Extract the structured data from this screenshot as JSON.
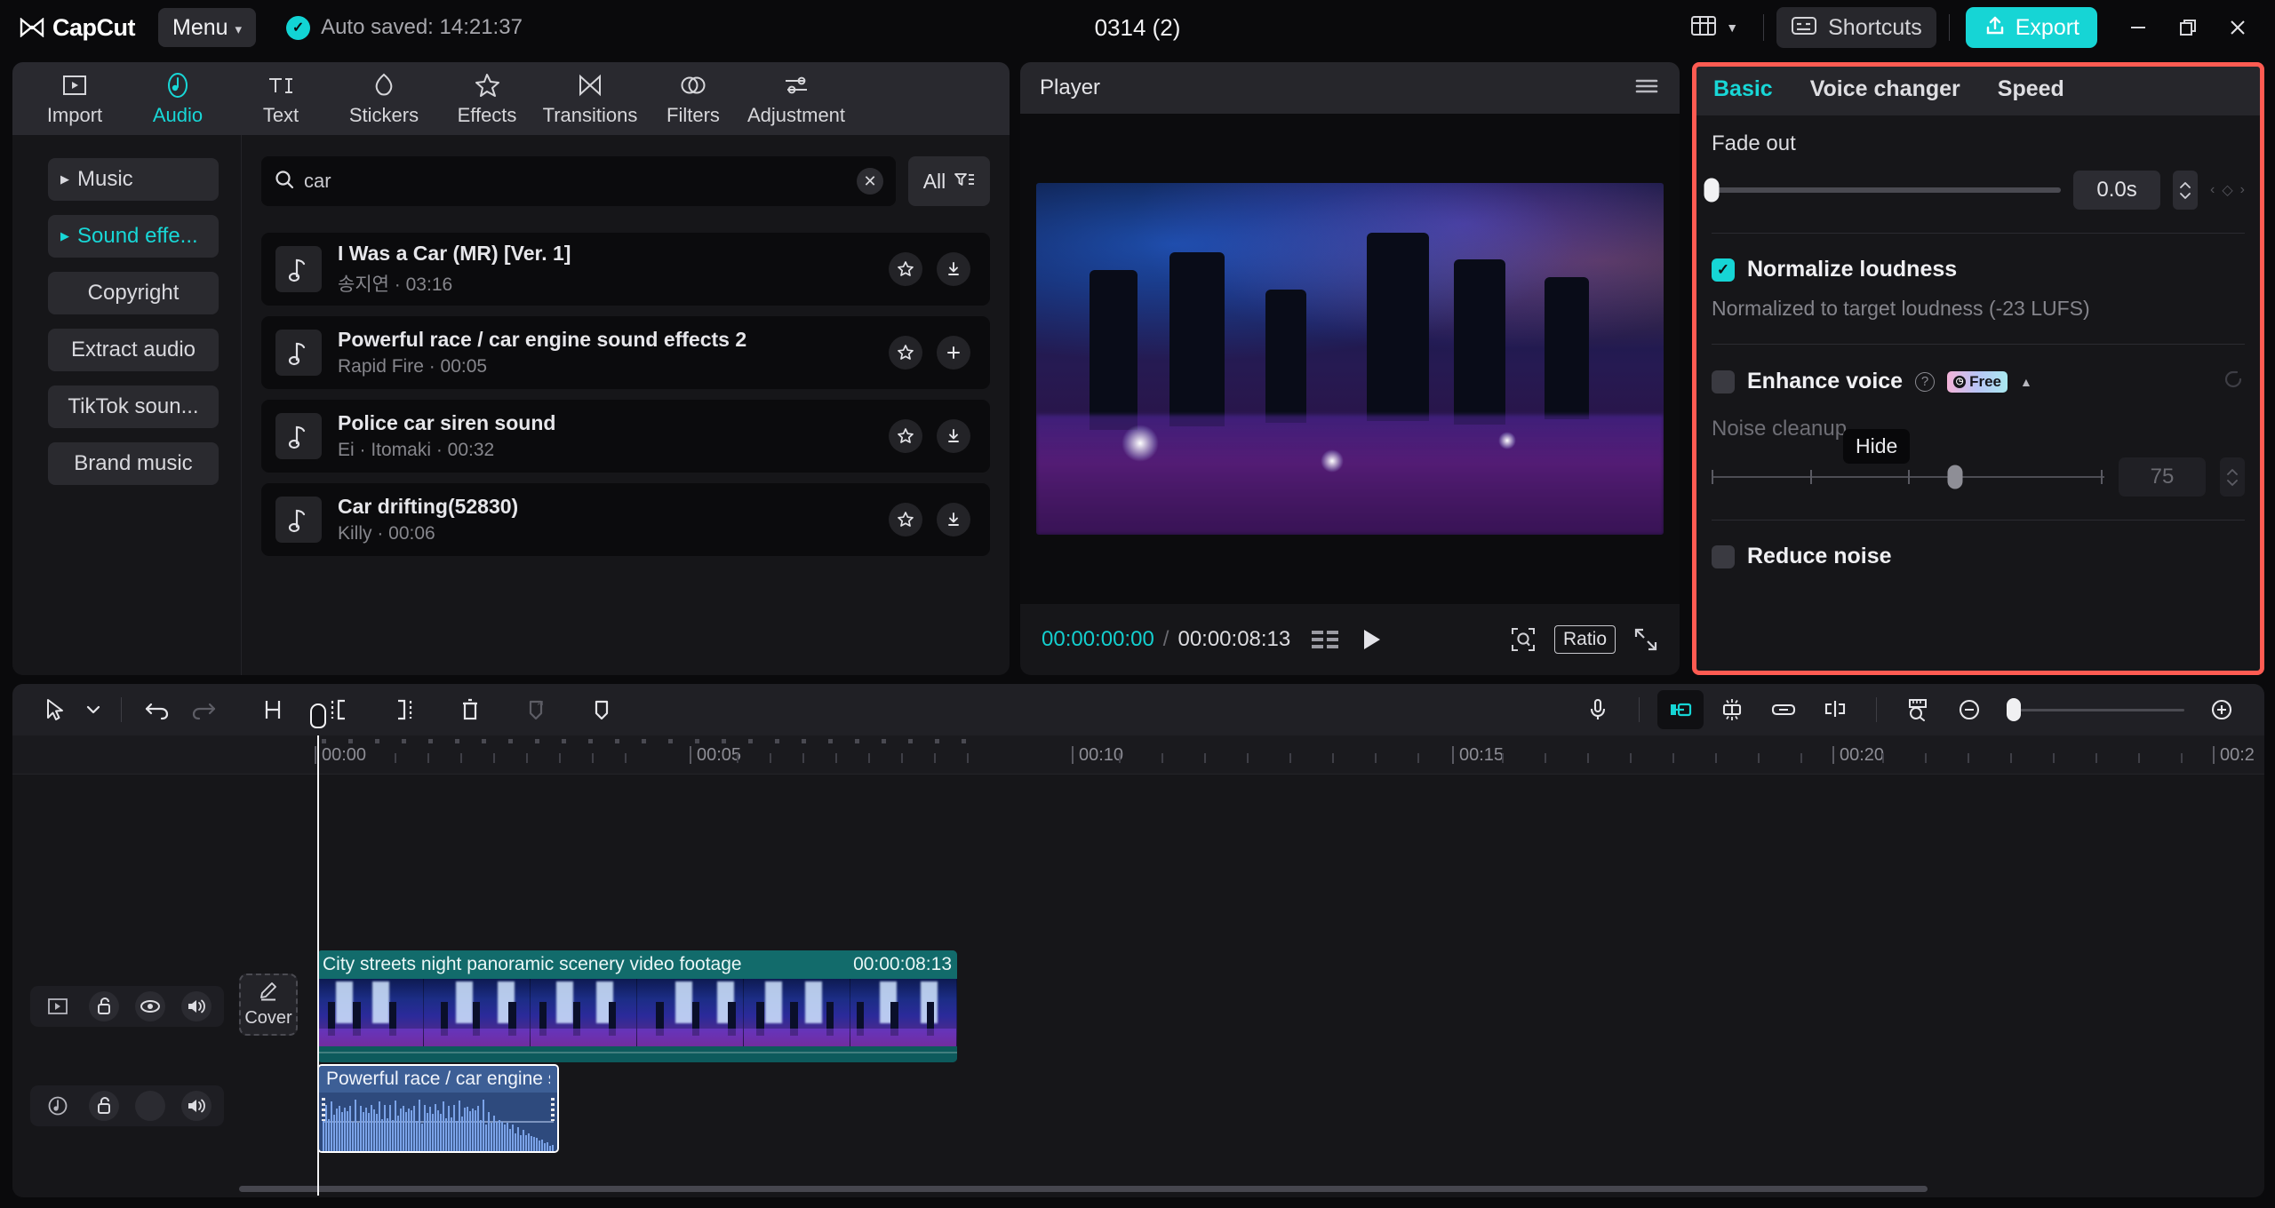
{
  "titlebar": {
    "app_name": "CapCut",
    "menu_label": "Menu",
    "autosave_text": "Auto saved: 14:21:37",
    "project_title": "0314 (2)",
    "shortcuts_label": "Shortcuts",
    "export_label": "Export",
    "accent_color": "#16d5d5"
  },
  "nav_tabs": [
    {
      "label": "Import",
      "icon": "import-icon",
      "active": false
    },
    {
      "label": "Audio",
      "icon": "audio-note-icon",
      "active": true
    },
    {
      "label": "Text",
      "icon": "text-ti-icon",
      "active": false
    },
    {
      "label": "Stickers",
      "icon": "sticker-icon",
      "active": false
    },
    {
      "label": "Effects",
      "icon": "effects-star-icon",
      "active": false
    },
    {
      "label": "Transitions",
      "icon": "transitions-icon",
      "active": false
    },
    {
      "label": "Filters",
      "icon": "filters-icon",
      "active": false
    },
    {
      "label": "Adjustment",
      "icon": "adjustment-sliders-icon",
      "active": false
    }
  ],
  "categories": [
    {
      "label": "Music",
      "expandable": true,
      "active": false
    },
    {
      "label": "Sound effe...",
      "expandable": true,
      "active": true
    },
    {
      "label": "Copyright",
      "expandable": false,
      "active": false
    },
    {
      "label": "Extract audio",
      "expandable": false,
      "active": false
    },
    {
      "label": "TikTok soun...",
      "expandable": false,
      "active": false
    },
    {
      "label": "Brand music",
      "expandable": false,
      "active": false
    }
  ],
  "search": {
    "value": "car",
    "placeholder": "Search",
    "filter_label": "All"
  },
  "tracks": [
    {
      "title": "I Was a Car (MR) [Ver. 1]",
      "subtitle": "송지연 · 03:16",
      "action": "download"
    },
    {
      "title": "Powerful race / car engine sound effects 2",
      "subtitle": "Rapid Fire · 00:05",
      "action": "add"
    },
    {
      "title": "Police car siren sound",
      "subtitle": "Ei · Itomaki · 00:32",
      "action": "download"
    },
    {
      "title": "Car drifting(52830)",
      "subtitle": "Killy · 00:06",
      "action": "download"
    }
  ],
  "player": {
    "title": "Player",
    "current_time": "00:00:00:00",
    "separator": "/",
    "total_time": "00:00:08:13",
    "ratio_label": "Ratio"
  },
  "right_panel": {
    "tabs": [
      {
        "label": "Basic",
        "active": true
      },
      {
        "label": "Voice changer",
        "active": false
      },
      {
        "label": "Speed",
        "active": false
      }
    ],
    "fade_out": {
      "label": "Fade out",
      "value": "0.0s",
      "slider_percent": 0
    },
    "normalize": {
      "label": "Normalize loudness",
      "checked": true,
      "note": "Normalized to target loudness (-23 LUFS)"
    },
    "enhance_voice": {
      "label": "Enhance voice",
      "checked": false,
      "badge": "Free",
      "noise_cleanup_label": "Noise cleanup",
      "noise_cleanup_value": "75",
      "noise_cleanup_percent": 62,
      "tooltip": "Hide"
    },
    "reduce_noise": {
      "label": "Reduce noise",
      "checked": false
    }
  },
  "timeline": {
    "toolbar_left": [
      {
        "icon": "select-cursor-icon",
        "state": "normal"
      },
      {
        "icon": "chevron-down-icon",
        "state": "normal"
      },
      {
        "icon": "undo-icon",
        "state": "normal"
      },
      {
        "icon": "redo-icon",
        "state": "dim"
      },
      {
        "icon": "split-icon",
        "state": "normal"
      },
      {
        "icon": "trim-left-icon",
        "state": "normal"
      },
      {
        "icon": "trim-right-icon",
        "state": "normal"
      },
      {
        "icon": "delete-trash-icon",
        "state": "normal"
      },
      {
        "icon": "ai-marker-icon",
        "state": "dim"
      },
      {
        "icon": "marker-icon",
        "state": "normal"
      }
    ],
    "toolbar_right": [
      {
        "icon": "microphone-icon",
        "state": "normal"
      },
      {
        "icon": "magnetic-snap-icon",
        "state": "active"
      },
      {
        "icon": "auto-adjust-icon",
        "state": "normal"
      },
      {
        "icon": "link-icon",
        "state": "normal"
      },
      {
        "icon": "adsorption-icon",
        "state": "normal"
      },
      {
        "icon": "fit-to-screen-icon",
        "state": "normal"
      },
      {
        "icon": "zoom-out-icon",
        "state": "normal"
      },
      {
        "icon": "zoom-in-icon",
        "state": "normal"
      }
    ],
    "ruler_labels": [
      "00:00",
      "00:05",
      "00:10",
      "00:15",
      "00:20",
      "00:2"
    ],
    "cover_label": "Cover",
    "video_clip": {
      "title": "City streets night panoramic scenery video footage",
      "duration": "00:00:08:13"
    },
    "audio_clip": {
      "title": "Powerful race / car engine sound effe"
    },
    "video_track_controls": [
      "video-thumb-icon",
      "unlock-icon",
      "eye-visible-icon",
      "volume-icon"
    ],
    "audio_track_controls": [
      "audio-note-icon",
      "unlock-icon",
      "blank-icon",
      "volume-icon"
    ]
  }
}
